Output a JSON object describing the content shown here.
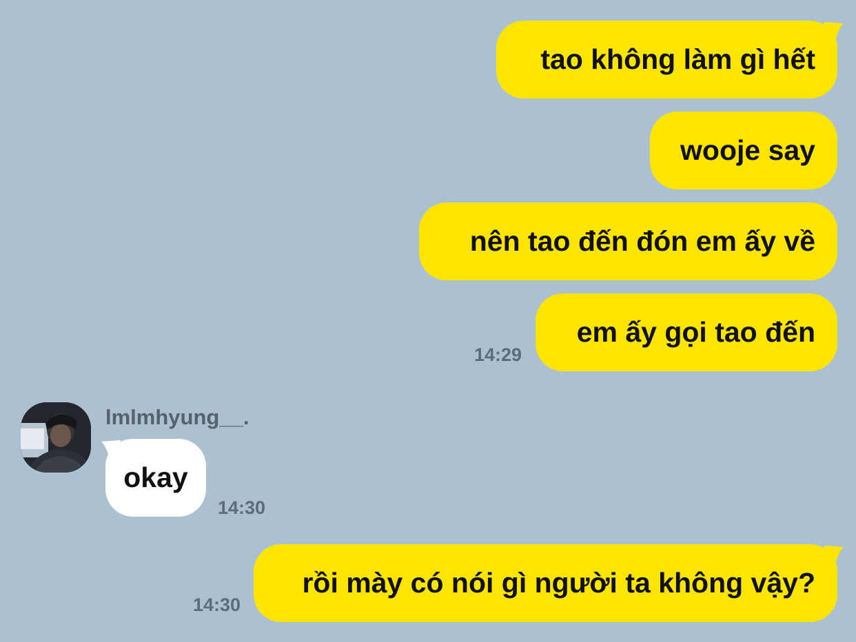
{
  "chat": {
    "messages": [
      {
        "direction": "outgoing",
        "text": "tao không làm gì hết"
      },
      {
        "direction": "outgoing",
        "text": "wooje say"
      },
      {
        "direction": "outgoing",
        "text": "nên tao đến đón em ấy về"
      },
      {
        "direction": "outgoing",
        "text": "em ấy gọi tao đến",
        "time": "14:29"
      },
      {
        "direction": "incoming",
        "sender": "lmlmhyung__.",
        "text": "okay",
        "time": "14:30"
      },
      {
        "direction": "outgoing",
        "text": "rồi mày có nói gì người ta không vậy?",
        "time": "14:30"
      }
    ]
  },
  "colors": {
    "background": "#abc1d1",
    "outgoing_bubble": "#fee500",
    "incoming_bubble": "#ffffff",
    "timestamp": "#5e6c78"
  },
  "icons": {
    "avatar": "profile-photo"
  }
}
